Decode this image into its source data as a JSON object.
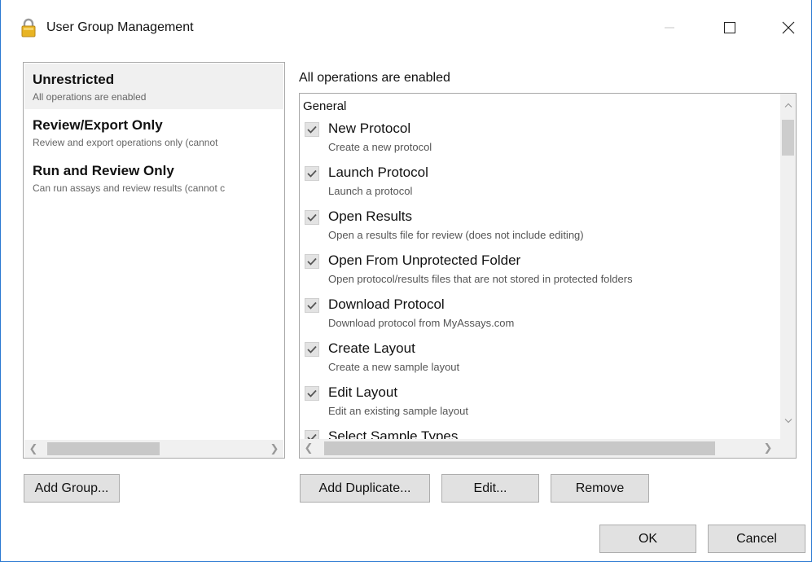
{
  "window": {
    "title": "User Group Management"
  },
  "groups": [
    {
      "name": "Unrestricted",
      "desc": "All operations are enabled",
      "selected": true
    },
    {
      "name": "Review/Export Only",
      "desc": "Review and export operations only (cannot"
    },
    {
      "name": "Run and Review Only",
      "desc": "Can run assays and review results (cannot c"
    }
  ],
  "operations_header": "All operations are enabled",
  "operations": {
    "section": "General",
    "items": [
      {
        "label": "New Protocol",
        "desc": "Create a new protocol",
        "checked": true
      },
      {
        "label": "Launch Protocol",
        "desc": "Launch a protocol",
        "checked": true
      },
      {
        "label": "Open Results",
        "desc": "Open a results file for review (does not include editing)",
        "checked": true
      },
      {
        "label": "Open From Unprotected Folder",
        "desc": "Open protocol/results files that are not stored in protected folders",
        "checked": true
      },
      {
        "label": "Download Protocol",
        "desc": "Download protocol from MyAssays.com",
        "checked": true
      },
      {
        "label": "Create Layout",
        "desc": "Create a new sample layout",
        "checked": true
      },
      {
        "label": "Edit Layout",
        "desc": "Edit an existing sample layout",
        "checked": true
      },
      {
        "label": "Select Sample Types",
        "desc": "",
        "checked": true
      }
    ]
  },
  "buttons": {
    "add_group": "Add Group...",
    "add_duplicate": "Add Duplicate...",
    "edit": "Edit...",
    "remove": "Remove",
    "ok": "OK",
    "cancel": "Cancel"
  },
  "icons": {
    "title": "lock-icon",
    "checkmark": "checkmark-icon"
  },
  "colors": {
    "window_border": "#2b79d2",
    "selected_row": "#f0f0f0",
    "button_face": "#e1e1e1"
  }
}
